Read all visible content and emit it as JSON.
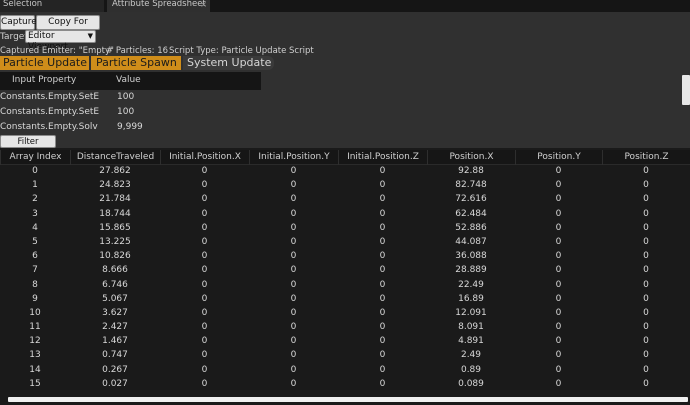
{
  "tabs": {
    "selection": "Selection",
    "attribute_spreadsheet": "Attribute Spreadsheet",
    "close_glyph": "×"
  },
  "toolbar": {
    "capture_label": "Capture",
    "copy_label": "Copy For Excel"
  },
  "target": {
    "label": "Target:",
    "value": "Editor Viewport"
  },
  "info": {
    "emitter": "Captured Emitter: \"Empty\"",
    "particles": "# Particles: 16",
    "script_type": "Script Type: Particle Update Script"
  },
  "script_tabs": [
    "Particle Update",
    "Particle Spawn",
    "System Update"
  ],
  "properties": {
    "headers": {
      "input": "Input Property",
      "value": "Value"
    },
    "rows": [
      {
        "name": "Constants.Empty.SetE",
        "value": "100"
      },
      {
        "name": "Constants.Empty.SetE",
        "value": "100"
      },
      {
        "name": "Constants.Empty.Solv",
        "value": "9,999"
      }
    ]
  },
  "filter_label": "Filter Attributes",
  "grid": {
    "columns": [
      "Array Index",
      "DistanceTraveled",
      "Initial.Position.X",
      "Initial.Position.Y",
      "Initial.Position.Z",
      "Position.X",
      "Position.Y",
      "Position.Z"
    ],
    "rows": [
      [
        "0",
        "27.862",
        "0",
        "0",
        "0",
        "92.88",
        "0",
        "0"
      ],
      [
        "1",
        "24.823",
        "0",
        "0",
        "0",
        "82.748",
        "0",
        "0"
      ],
      [
        "2",
        "21.784",
        "0",
        "0",
        "0",
        "72.616",
        "0",
        "0"
      ],
      [
        "3",
        "18.744",
        "0",
        "0",
        "0",
        "62.484",
        "0",
        "0"
      ],
      [
        "4",
        "15.865",
        "0",
        "0",
        "0",
        "52.886",
        "0",
        "0"
      ],
      [
        "5",
        "13.225",
        "0",
        "0",
        "0",
        "44.087",
        "0",
        "0"
      ],
      [
        "6",
        "10.826",
        "0",
        "0",
        "0",
        "36.088",
        "0",
        "0"
      ],
      [
        "7",
        "8.666",
        "0",
        "0",
        "0",
        "28.889",
        "0",
        "0"
      ],
      [
        "8",
        "6.746",
        "0",
        "0",
        "0",
        "22.49",
        "0",
        "0"
      ],
      [
        "9",
        "5.067",
        "0",
        "0",
        "0",
        "16.89",
        "0",
        "0"
      ],
      [
        "10",
        "3.627",
        "0",
        "0",
        "0",
        "12.091",
        "0",
        "0"
      ],
      [
        "11",
        "2.427",
        "0",
        "0",
        "0",
        "8.091",
        "0",
        "0"
      ],
      [
        "12",
        "1.467",
        "0",
        "0",
        "0",
        "4.891",
        "0",
        "0"
      ],
      [
        "13",
        "0.747",
        "0",
        "0",
        "0",
        "2.49",
        "0",
        "0"
      ],
      [
        "14",
        "0.267",
        "0",
        "0",
        "0",
        "0.89",
        "0",
        "0"
      ],
      [
        "15",
        "0.027",
        "0",
        "0",
        "0",
        "0.089",
        "0",
        "0"
      ]
    ]
  }
}
